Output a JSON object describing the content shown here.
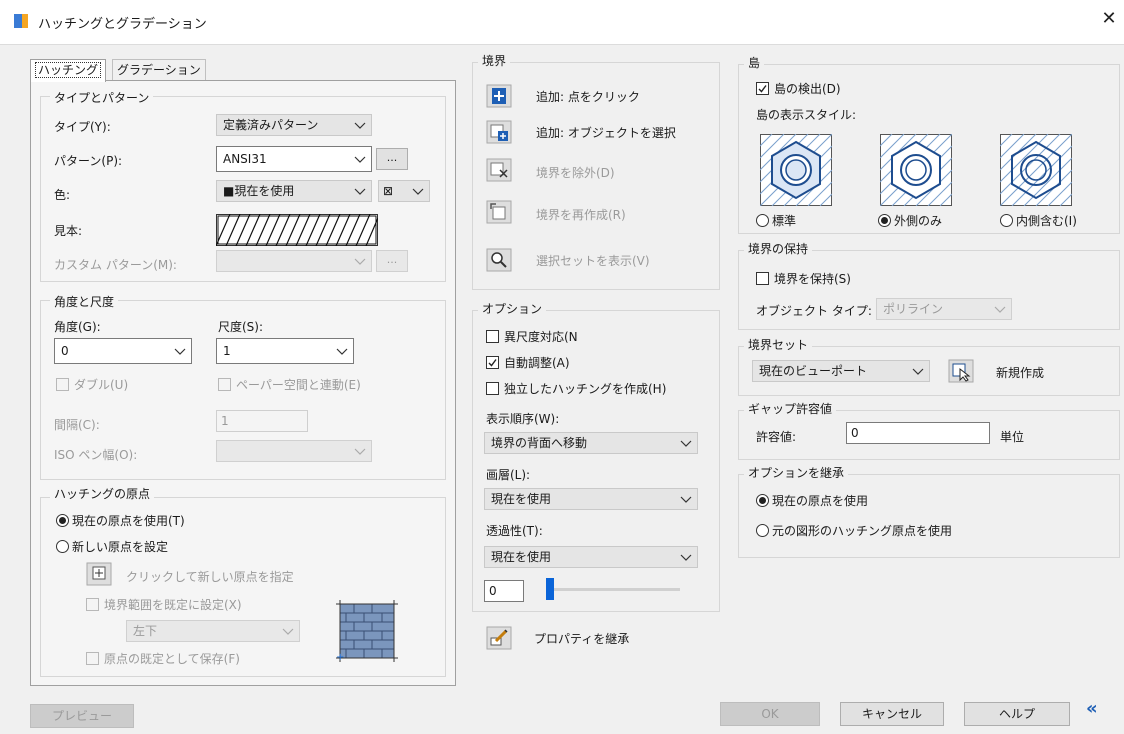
{
  "window": {
    "title": "ハッチングとグラデーション",
    "close_glyph": "✕"
  },
  "tabs": {
    "hatch": "ハッチング",
    "gradient": "グラデーション"
  },
  "type_pattern": {
    "group_label": "タイプとパターン",
    "type_label": "タイプ(Y):",
    "type_value": "定義済みパターン",
    "pattern_label": "パターン(P):",
    "pattern_value": "ANSI31",
    "browse_label": "...",
    "color_label": "色:",
    "color_value": "■現在を使用",
    "color2_value": "⊠",
    "sample_label": "見本:",
    "custom_label": "カスタム パターン(M):",
    "custom_browse": "..."
  },
  "angle_scale": {
    "group_label": "角度と尺度",
    "angle_label": "角度(G):",
    "angle_value": "0",
    "scale_label": "尺度(S):",
    "scale_value": "1",
    "double_label": "ダブル(U)",
    "paperspace_label": "ペーパー空間と連動(E)",
    "spacing_label": "間隔(C):",
    "spacing_value": "1",
    "iso_label": "ISO ペン幅(O):"
  },
  "origin": {
    "group_label": "ハッチングの原点",
    "use_current": "現在の原点を使用(T)",
    "set_new": "新しい原点を設定",
    "click_new": "クリックして新しい原点を指定",
    "default_extents": "境界範囲を既定に設定(X)",
    "position_value": "左下",
    "store_default": "原点の既定として保存(F)"
  },
  "boundaries": {
    "group_label": "境界",
    "add_pick": "追加: 点をクリック",
    "add_select": "追加: オブジェクトを選択",
    "remove": "境界を除外(D)",
    "recreate": "境界を再作成(R)",
    "view_sel": "選択セットを表示(V)"
  },
  "options": {
    "group_label": "オプション",
    "annotative": "異尺度対応(N",
    "associative": "自動調整(A)",
    "separate": "独立したハッチングを作成(H)",
    "draw_order_label": "表示順序(W):",
    "draw_order_value": "境界の背面へ移動",
    "layer_label": "画層(L):",
    "layer_value": "現在を使用",
    "transparency_label": "透過性(T):",
    "transparency_value": "現在を使用",
    "transparency_num": "0",
    "inherit": "プロパティを継承"
  },
  "islands": {
    "group_label": "島",
    "detect": "島の検出(D)",
    "style_label": "島の表示スタイル:",
    "normal": "標準",
    "outer": "外側のみ",
    "ignore": "内側含む(I)"
  },
  "retain": {
    "group_label": "境界の保持",
    "retain_label": "境界を保持(S)",
    "objtype_label": "オブジェクト タイプ:",
    "objtype_value": "ポリライン"
  },
  "boundary_set": {
    "group_label": "境界セット",
    "value": "現在のビューポート",
    "new_label": "新規作成"
  },
  "gap": {
    "group_label": "ギャップ許容値",
    "tol_label": "許容値:",
    "tol_value": "0",
    "units": "単位"
  },
  "inherit_opts": {
    "group_label": "オプションを継承",
    "use_current": "現在の原点を使用",
    "use_source": "元の図形のハッチング原点を使用"
  },
  "buttons": {
    "preview": "プレビュー",
    "ok": "OK",
    "cancel": "キャンセル",
    "help": "ヘルプ",
    "more": "«"
  }
}
